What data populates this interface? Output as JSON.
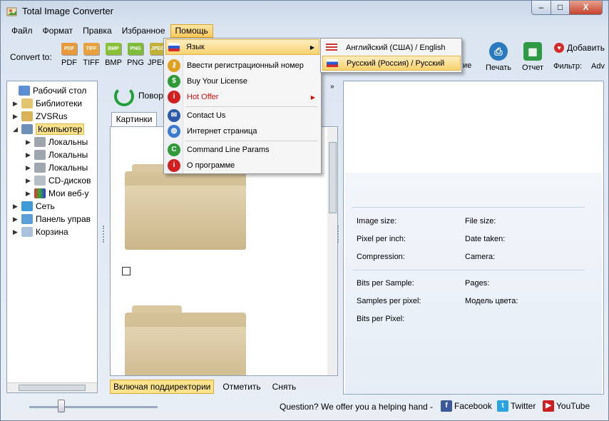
{
  "window": {
    "title": "Total Image Converter",
    "min": "–",
    "max": "□",
    "close": "X"
  },
  "menubar": [
    "Файл",
    "Формат",
    "Правка",
    "Избранное",
    "Помощь"
  ],
  "toolbar": {
    "convert_to": "Convert to:",
    "formats": [
      {
        "label": "PDF",
        "icon_text": "PDF",
        "color": "#e79a3c"
      },
      {
        "label": "TIFF",
        "icon_text": "TIFF",
        "color": "#e8a23e"
      },
      {
        "label": "BMP",
        "icon_text": "BMP",
        "color": "#8abf3a"
      },
      {
        "label": "PNG",
        "icon_text": "PNG",
        "color": "#7fbb3b"
      },
      {
        "label": "JPEG",
        "icon_text": "JPEG",
        "color": "#c1b03a"
      }
    ],
    "partial_label": "ие",
    "print": "Печать",
    "report": "Отчет",
    "add": "Добавить",
    "filter": "Фильтр:",
    "filter_value": "Adv"
  },
  "tree": [
    {
      "label": "Рабочий стол",
      "icon": "desktop-icon"
    },
    {
      "label": "Библиотеки",
      "icon": "libraries-icon"
    },
    {
      "label": "ZVSRus",
      "icon": "user-folder-icon"
    },
    {
      "label": "Компьютер",
      "icon": "computer-icon"
    },
    {
      "label": "Локальны",
      "icon": "drive-icon"
    },
    {
      "label": "Локальны",
      "icon": "drive-icon"
    },
    {
      "label": "Локальны",
      "icon": "drive-icon"
    },
    {
      "label": "CD-дисков",
      "icon": "cd-drive-icon"
    },
    {
      "label": "Мои веб-у",
      "icon": "web-nodes-icon"
    },
    {
      "label": "Сеть",
      "icon": "network-icon"
    },
    {
      "label": "Панель управ",
      "icon": "control-panel-icon"
    },
    {
      "label": "Корзина",
      "icon": "recycle-bin-icon"
    }
  ],
  "middle": {
    "path_text": "Повор",
    "tab": "Картинки",
    "include_subdirs": "Включая поддиректории",
    "check_all": "Отметить",
    "uncheck": "Снять"
  },
  "info": {
    "image_size": "Image size:",
    "file_size": "File size:",
    "ppi": "Pixel per inch:",
    "date_taken": "Date taken:",
    "compression": "Compression:",
    "camera": "Camera:",
    "bits_per_sample": "Bits per Sample:",
    "pages": "Pages:",
    "samples_per_pixel": "Samples per pixel:",
    "color_model": "Модель цвета:",
    "bits_per_pixel": "Bits per Pixel:"
  },
  "status": {
    "question": "Question? We offer you a helping hand -",
    "facebook": "Facebook",
    "twitter": "Twitter",
    "youtube": "YouTube"
  },
  "help_menu": {
    "language": "Язык",
    "register": "Ввести регистрационный номер",
    "buy": "Buy Your License",
    "hot_offer": "Hot Offer",
    "contact": "Contact Us",
    "web": "Интернет страница",
    "cmd": "Command Line Params",
    "about": "О программе"
  },
  "language_menu": {
    "english": "Английский (США) / English",
    "russian": "Русский (Россия) / Русский"
  },
  "colors": {
    "accent": "#f9c95a",
    "hot_offer": "#d01010"
  }
}
